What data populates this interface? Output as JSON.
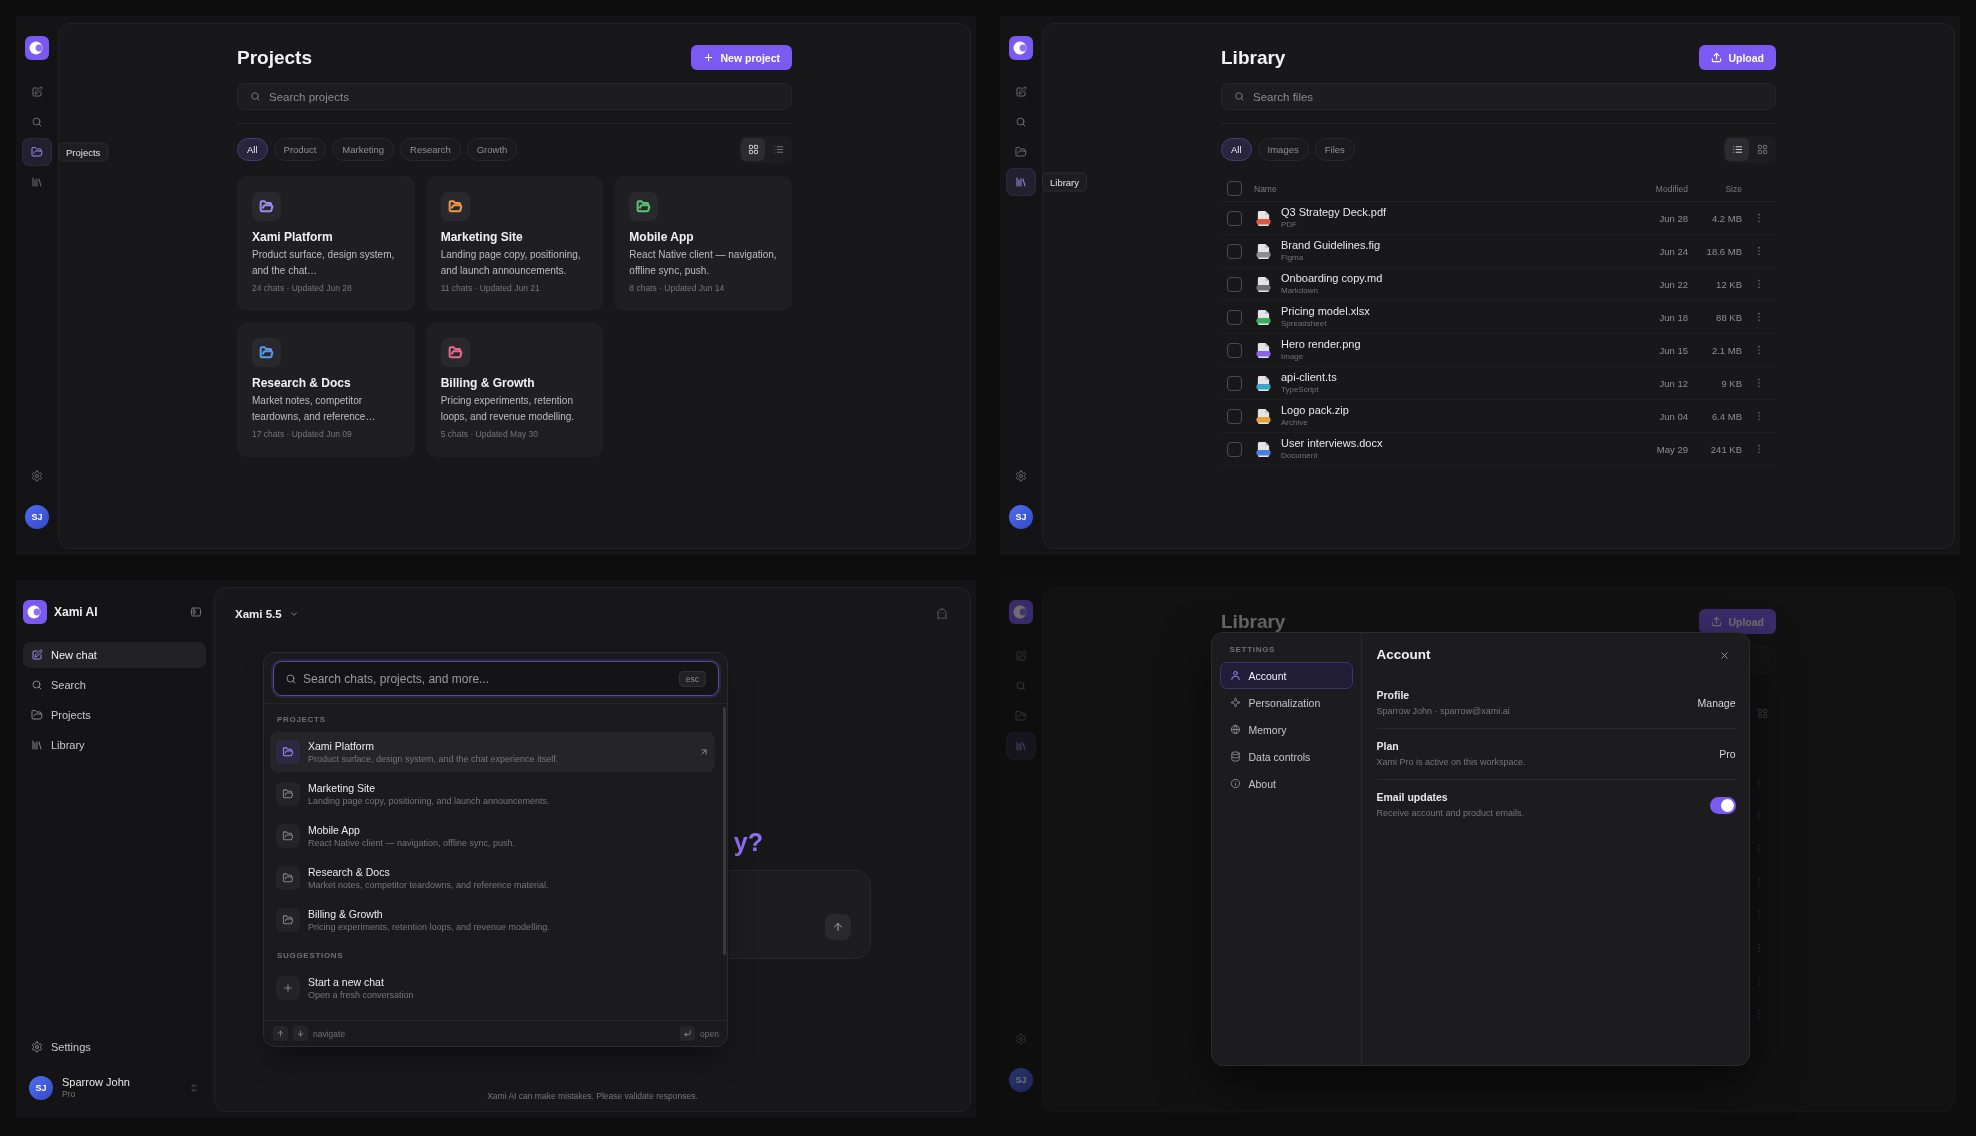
{
  "projects_view": {
    "rail": {
      "items": [
        {
          "kind": "compose",
          "selected": false
        },
        {
          "kind": "search",
          "selected": false
        },
        {
          "kind": "folder",
          "selected": true
        },
        {
          "kind": "library",
          "selected": false
        }
      ],
      "tooltip": "Projects",
      "avatar": "SJ"
    },
    "title": "Projects",
    "new_button": "New project",
    "search": {
      "placeholder": "Search projects"
    },
    "filters": [
      {
        "label": "All",
        "selected": true
      },
      {
        "label": "Product",
        "selected": false
      },
      {
        "label": "Marketing",
        "selected": false
      },
      {
        "label": "Research",
        "selected": false
      },
      {
        "label": "Growth",
        "selected": false
      }
    ],
    "view_modes": [
      {
        "kind": "grid",
        "selected": true
      },
      {
        "kind": "list",
        "selected": false
      }
    ],
    "projects": [
      {
        "name": "Xami Platform",
        "description": "Product surface, design system, and the chat…",
        "meta": "24 chats · Updated Jun 28",
        "color": "#9d8cf6"
      },
      {
        "name": "Marketing Site",
        "description": "Landing page copy, positioning, and launch announcements.",
        "meta": "11 chats · Updated Jun 21",
        "color": "#ef9a4a"
      },
      {
        "name": "Mobile App",
        "description": "React Native client — navigation, offline sync, push.",
        "meta": "8 chats · Updated Jun 14",
        "color": "#5cc574"
      },
      {
        "name": "Research & Docs",
        "description": "Market notes, competitor teardowns, and reference…",
        "meta": "17 chats · Updated Jun 09",
        "color": "#5b9bef"
      },
      {
        "name": "Billing & Growth",
        "description": "Pricing experiments, retention loops, and revenue modelling.",
        "meta": "5 chats · Updated May 30",
        "color": "#ea6893"
      }
    ]
  },
  "library_view": {
    "rail": {
      "items": [
        {
          "kind": "compose",
          "selected": false
        },
        {
          "kind": "search",
          "selected": false
        },
        {
          "kind": "folder",
          "selected": false
        },
        {
          "kind": "library",
          "selected": true
        }
      ],
      "tooltip": "Library",
      "avatar": "SJ"
    },
    "title": "Library",
    "upload_button": "Upload",
    "search": {
      "placeholder": "Search files"
    },
    "filters": [
      {
        "label": "All",
        "selected": true
      },
      {
        "label": "Images",
        "selected": false
      },
      {
        "label": "Files",
        "selected": false
      }
    ],
    "view_modes": [
      {
        "kind": "list",
        "selected": true
      },
      {
        "kind": "grid",
        "selected": false
      }
    ],
    "table": {
      "select_all_checked": false,
      "columns": [
        "Name",
        "Modified",
        "Size"
      ],
      "rows": [
        {
          "name": "Q3 Strategy Deck.pdf",
          "type": "PDF",
          "modified": "Jun 28",
          "size": "4.2 MB",
          "color": "#e2553f",
          "checked": false
        },
        {
          "name": "Brand Guidelines.fig",
          "type": "Figma",
          "modified": "Jun 24",
          "size": "18.6 MB",
          "color": "#8c8c92",
          "checked": false
        },
        {
          "name": "Onboarding copy.md",
          "type": "Markdown",
          "modified": "Jun 22",
          "size": "12 KB",
          "color": "#6f6f75",
          "checked": false
        },
        {
          "name": "Pricing model.xlsx",
          "type": "Spreadsheet",
          "modified": "Jun 18",
          "size": "88 KB",
          "color": "#3fae5a",
          "checked": false
        },
        {
          "name": "Hero render.png",
          "type": "Image",
          "modified": "Jun 15",
          "size": "2.1 MB",
          "color": "#8a63e8",
          "checked": false
        },
        {
          "name": "api-client.ts",
          "type": "TypeScript",
          "modified": "Jun 12",
          "size": "9 KB",
          "color": "#3aa6c8",
          "checked": false
        },
        {
          "name": "Logo pack.zip",
          "type": "Archive",
          "modified": "Jun 04",
          "size": "6.4 MB",
          "color": "#e6a23c",
          "checked": false
        },
        {
          "name": "User interviews.docx",
          "type": "Document",
          "modified": "May 29",
          "size": "241 KB",
          "color": "#4a7fe0",
          "checked": false
        }
      ]
    }
  },
  "chat_view": {
    "sidebar": {
      "brand": "Xami AI",
      "items": [
        {
          "kind": "compose",
          "label": "New chat",
          "selected": true
        },
        {
          "kind": "search",
          "label": "Search",
          "selected": false
        },
        {
          "kind": "folder",
          "label": "Projects",
          "selected": false
        },
        {
          "kind": "library",
          "label": "Library",
          "selected": false
        }
      ],
      "settings": "Settings",
      "user": {
        "initials": "SJ",
        "name": "Sparrow John",
        "plan": "Pro"
      }
    },
    "model": "Xami 5.5",
    "hero_heading": "y?",
    "disclaimer": "Xami AI can make mistakes. Please validate responses.",
    "palette": {
      "search": {
        "placeholder": "Search chats, projects, and more...",
        "shortcut": "esc"
      },
      "sections": [
        {
          "title": "PROJECTS",
          "items": [
            {
              "kind": "project",
              "title": "Xami Platform",
              "subtitle": "Product surface, design system, and the chat experience itself.",
              "selected": true
            },
            {
              "kind": "project",
              "title": "Marketing Site",
              "subtitle": "Landing page copy, positioning, and launch announcements.",
              "selected": false
            },
            {
              "kind": "project",
              "title": "Mobile App",
              "subtitle": "React Native client — navigation, offline sync, push.",
              "selected": false
            },
            {
              "kind": "project",
              "title": "Research & Docs",
              "subtitle": "Market notes, competitor teardowns, and reference material.",
              "selected": false
            },
            {
              "kind": "project",
              "title": "Billing & Growth",
              "subtitle": "Pricing experiments, retention loops, and revenue modelling.",
              "selected": false
            }
          ]
        },
        {
          "title": "SUGGESTIONS",
          "items": [
            {
              "kind": "new_chat",
              "title": "Start a new chat",
              "subtitle": "Open a fresh conversation",
              "selected": false
            }
          ]
        }
      ],
      "footer": {
        "navigate_hint": "navigate",
        "open_hint": "open"
      }
    }
  },
  "settings_view": {
    "rail": {
      "items": [
        {
          "kind": "compose",
          "selected": false
        },
        {
          "kind": "search",
          "selected": false
        },
        {
          "kind": "folder",
          "selected": false
        },
        {
          "kind": "library",
          "selected": true
        }
      ],
      "avatar": "SJ"
    },
    "title": "Library",
    "upload_button": "Upload",
    "modal": {
      "nav_title": "SETTINGS",
      "nav": [
        {
          "kind": "account",
          "label": "Account",
          "selected": true
        },
        {
          "kind": "personalization",
          "label": "Personalization",
          "selected": false
        },
        {
          "kind": "memory",
          "label": "Memory",
          "selected": false
        },
        {
          "kind": "data",
          "label": "Data controls",
          "selected": false
        },
        {
          "kind": "about",
          "label": "About",
          "selected": false
        }
      ],
      "heading": "Account",
      "rows": [
        {
          "kind": "action",
          "title": "Profile",
          "description": "Sparrow John · sparrow@xami.ai",
          "value": "Manage"
        },
        {
          "kind": "value",
          "title": "Plan",
          "description": "Xami Pro is active on this workspace.",
          "value": "Pro"
        },
        {
          "kind": "toggle",
          "title": "Email updates",
          "description": "Receive account and product emails.",
          "on": true
        }
      ]
    }
  }
}
